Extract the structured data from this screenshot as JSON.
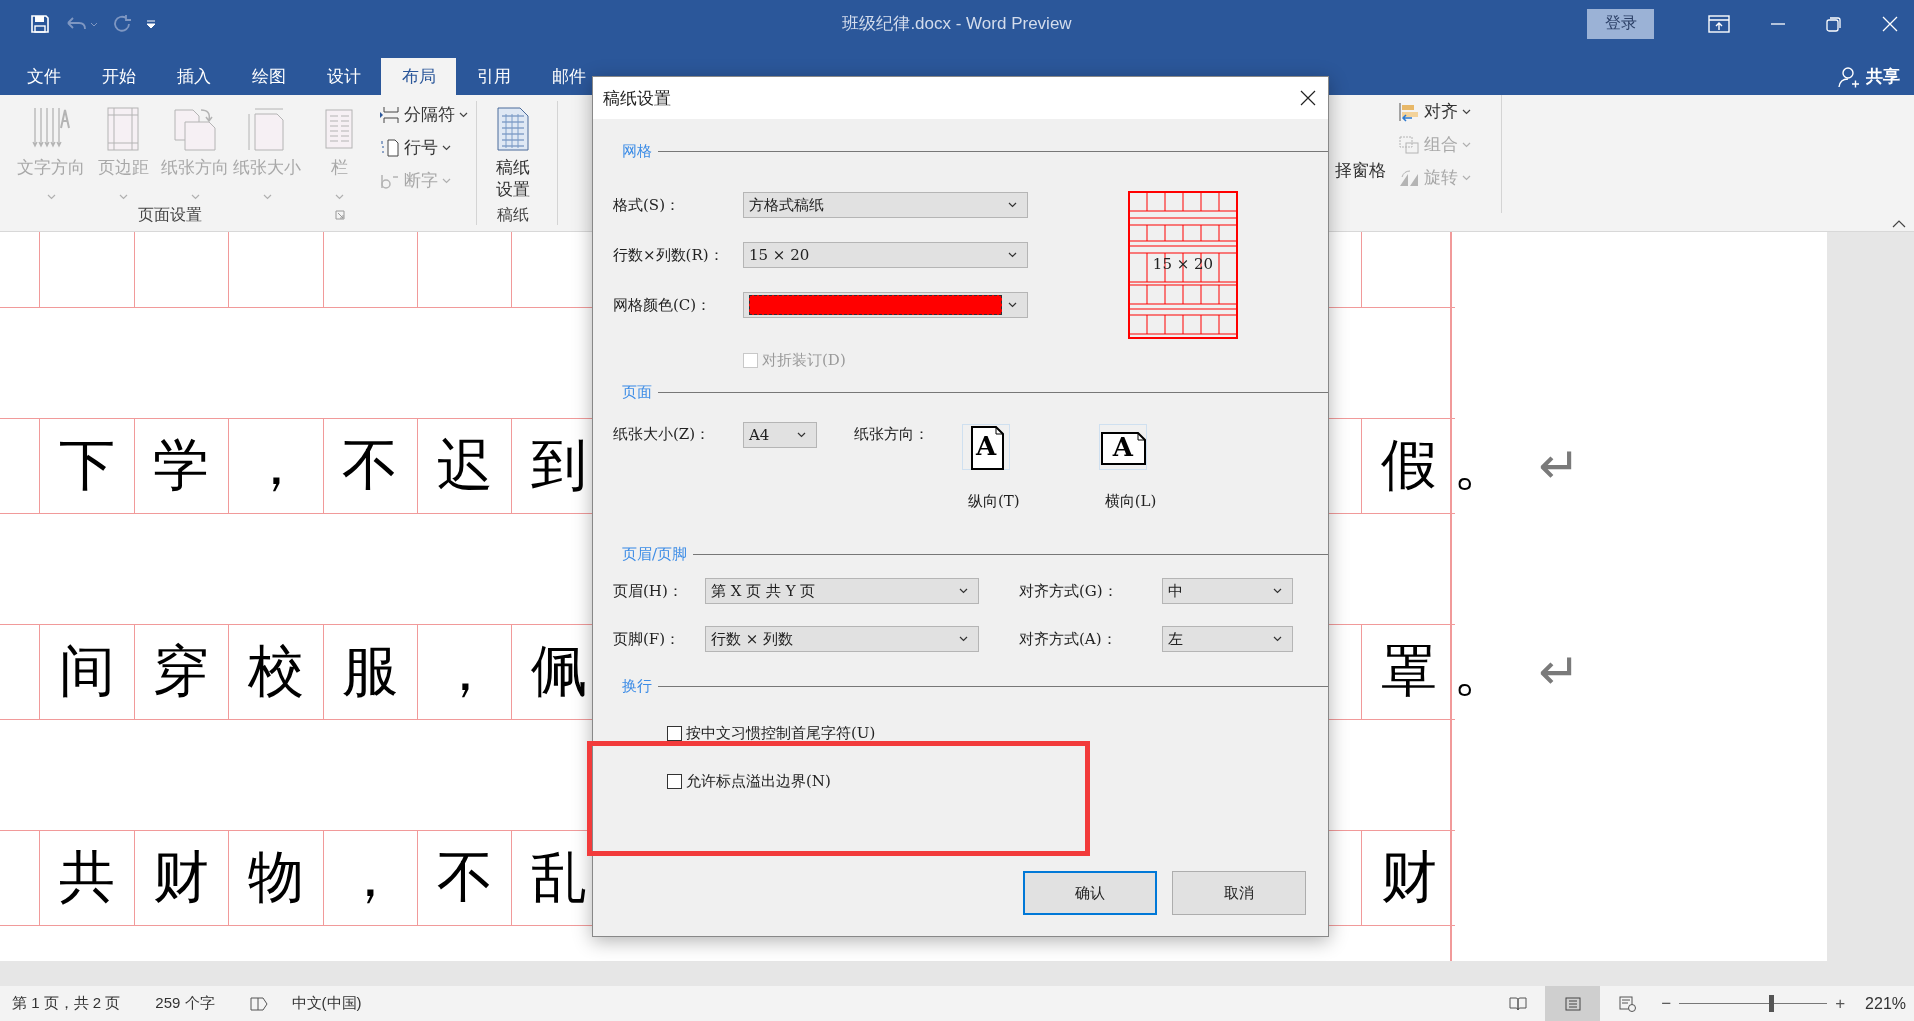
{
  "title_bar": {
    "title": "班级纪律.docx  -  Word Preview",
    "login": "登录"
  },
  "tabs": [
    {
      "label": "文件",
      "selected": false
    },
    {
      "label": "开始",
      "selected": false
    },
    {
      "label": "插入",
      "selected": false
    },
    {
      "label": "绘图",
      "selected": false
    },
    {
      "label": "设计",
      "selected": false
    },
    {
      "label": "布局",
      "selected": true
    },
    {
      "label": "引用",
      "selected": false
    },
    {
      "label": "邮件",
      "selected": false
    }
  ],
  "share": "共享",
  "ribbon": {
    "groups": [
      {
        "label": "页面设置",
        "large_buttons": [
          {
            "label": "文字方向",
            "kind": "text-direction",
            "disabled": true,
            "dropdown": true
          },
          {
            "label": "页边距",
            "kind": "margins",
            "disabled": true,
            "dropdown": true
          },
          {
            "label": "纸张方向",
            "kind": "orientation",
            "disabled": true,
            "dropdown": true
          },
          {
            "label": "纸张大小",
            "kind": "size",
            "disabled": true,
            "dropdown": true
          },
          {
            "label": "栏",
            "kind": "columns",
            "disabled": true,
            "dropdown": true
          }
        ],
        "small_buttons": [
          {
            "label": "分隔符",
            "kind": "breaks",
            "disabled": false
          },
          {
            "label": "行号",
            "kind": "line-numbers",
            "disabled": false
          },
          {
            "label": "断字",
            "kind": "hyphenation",
            "disabled": true
          }
        ]
      },
      {
        "label": "稿纸",
        "large_buttons": [
          {
            "label": "稿纸设置",
            "kind": "manuscript",
            "disabled": false,
            "dropdown": false
          }
        ]
      }
    ],
    "partial_button": "择窗格",
    "arrange": [
      {
        "label": "对齐",
        "kind": "align",
        "disabled": false
      },
      {
        "label": "组合",
        "kind": "group",
        "disabled": true
      },
      {
        "label": "旋转",
        "kind": "rotate",
        "disabled": true
      }
    ]
  },
  "document": {
    "lines": [
      {
        "left": [
          "下",
          "学",
          "，",
          "不",
          "迟",
          "到"
        ],
        "right": [
          "假"
        ],
        "after": "。",
        "mark": "↵"
      },
      {
        "left": [
          "间",
          "穿",
          "校",
          "服",
          "，",
          "佩"
        ],
        "right": [
          "罩"
        ],
        "after": "。",
        "mark": "↵"
      },
      {
        "left": [
          "共",
          "财",
          "物",
          "，",
          "不",
          "乱"
        ],
        "right": [
          "财"
        ]
      }
    ]
  },
  "dialog": {
    "title": "稿纸设置",
    "grid": {
      "heading": "网格",
      "fields": [
        {
          "label": "格式(S)：",
          "kind": "text",
          "value": "方格式稿纸"
        },
        {
          "label": "行数×列数(R)：",
          "kind": "text",
          "value": "15 × 20"
        },
        {
          "label": "网格颜色(C)：",
          "kind": "color",
          "color": "#ff0000"
        }
      ],
      "fold_binding": {
        "label": "对折装订(D)",
        "checked": false,
        "disabled": true
      },
      "preview": {
        "text": "15 × 20"
      }
    },
    "page": {
      "heading": "页面",
      "size_label": "纸张大小(Z)：",
      "size": "A4",
      "orientation_label": "纸张方向：",
      "orientations": [
        {
          "kind": "portrait",
          "icon_letter": "A",
          "label": "纵向(T)"
        },
        {
          "kind": "landscape",
          "icon_letter": "A",
          "label": "横向(L)"
        }
      ]
    },
    "header_footer": {
      "heading": "页眉/页脚",
      "rows": [
        {
          "label": "页眉(H)：",
          "value": "第 X 页 共 Y 页",
          "align_label": "对齐方式(G)：",
          "align": "中"
        },
        {
          "label": "页脚(F)：",
          "value": "行数 × 列数",
          "align_label": "对齐方式(A)：",
          "align": "左"
        }
      ]
    },
    "line_break": {
      "heading": "换行",
      "options": [
        {
          "label": "按中文习惯控制首尾字符(U)",
          "checked": false
        },
        {
          "label": "允许标点溢出边界(N)",
          "checked": false
        }
      ]
    },
    "buttons": [
      {
        "label": "确认",
        "default": true
      },
      {
        "label": "取消",
        "default": false
      }
    ]
  },
  "status_bar": {
    "page": "第 1 页，共 2 页",
    "words": "259 个字",
    "language": "中文(中国)",
    "views": [
      {
        "kind": "read",
        "selected": false
      },
      {
        "kind": "print",
        "selected": true
      },
      {
        "kind": "web",
        "selected": false
      }
    ],
    "zoom": {
      "out": "−",
      "in": "+",
      "level": 0.62,
      "reading": "221%"
    }
  }
}
